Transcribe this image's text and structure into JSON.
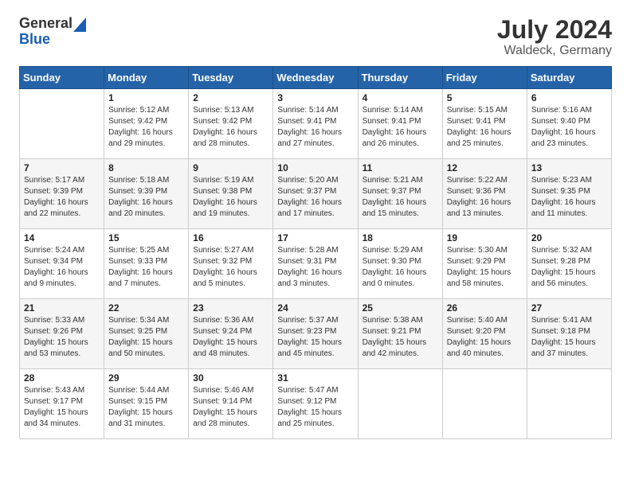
{
  "header": {
    "logo_general": "General",
    "logo_blue": "Blue",
    "title": "July 2024",
    "subtitle": "Waldeck, Germany"
  },
  "calendar": {
    "days_of_week": [
      "Sunday",
      "Monday",
      "Tuesday",
      "Wednesday",
      "Thursday",
      "Friday",
      "Saturday"
    ],
    "weeks": [
      [
        {
          "num": "",
          "info": ""
        },
        {
          "num": "1",
          "info": "Sunrise: 5:12 AM\nSunset: 9:42 PM\nDaylight: 16 hours\nand 29 minutes."
        },
        {
          "num": "2",
          "info": "Sunrise: 5:13 AM\nSunset: 9:42 PM\nDaylight: 16 hours\nand 28 minutes."
        },
        {
          "num": "3",
          "info": "Sunrise: 5:14 AM\nSunset: 9:41 PM\nDaylight: 16 hours\nand 27 minutes."
        },
        {
          "num": "4",
          "info": "Sunrise: 5:14 AM\nSunset: 9:41 PM\nDaylight: 16 hours\nand 26 minutes."
        },
        {
          "num": "5",
          "info": "Sunrise: 5:15 AM\nSunset: 9:41 PM\nDaylight: 16 hours\nand 25 minutes."
        },
        {
          "num": "6",
          "info": "Sunrise: 5:16 AM\nSunset: 9:40 PM\nDaylight: 16 hours\nand 23 minutes."
        }
      ],
      [
        {
          "num": "7",
          "info": "Sunrise: 5:17 AM\nSunset: 9:39 PM\nDaylight: 16 hours\nand 22 minutes."
        },
        {
          "num": "8",
          "info": "Sunrise: 5:18 AM\nSunset: 9:39 PM\nDaylight: 16 hours\nand 20 minutes."
        },
        {
          "num": "9",
          "info": "Sunrise: 5:19 AM\nSunset: 9:38 PM\nDaylight: 16 hours\nand 19 minutes."
        },
        {
          "num": "10",
          "info": "Sunrise: 5:20 AM\nSunset: 9:37 PM\nDaylight: 16 hours\nand 17 minutes."
        },
        {
          "num": "11",
          "info": "Sunrise: 5:21 AM\nSunset: 9:37 PM\nDaylight: 16 hours\nand 15 minutes."
        },
        {
          "num": "12",
          "info": "Sunrise: 5:22 AM\nSunset: 9:36 PM\nDaylight: 16 hours\nand 13 minutes."
        },
        {
          "num": "13",
          "info": "Sunrise: 5:23 AM\nSunset: 9:35 PM\nDaylight: 16 hours\nand 11 minutes."
        }
      ],
      [
        {
          "num": "14",
          "info": "Sunrise: 5:24 AM\nSunset: 9:34 PM\nDaylight: 16 hours\nand 9 minutes."
        },
        {
          "num": "15",
          "info": "Sunrise: 5:25 AM\nSunset: 9:33 PM\nDaylight: 16 hours\nand 7 minutes."
        },
        {
          "num": "16",
          "info": "Sunrise: 5:27 AM\nSunset: 9:32 PM\nDaylight: 16 hours\nand 5 minutes."
        },
        {
          "num": "17",
          "info": "Sunrise: 5:28 AM\nSunset: 9:31 PM\nDaylight: 16 hours\nand 3 minutes."
        },
        {
          "num": "18",
          "info": "Sunrise: 5:29 AM\nSunset: 9:30 PM\nDaylight: 16 hours\nand 0 minutes."
        },
        {
          "num": "19",
          "info": "Sunrise: 5:30 AM\nSunset: 9:29 PM\nDaylight: 15 hours\nand 58 minutes."
        },
        {
          "num": "20",
          "info": "Sunrise: 5:32 AM\nSunset: 9:28 PM\nDaylight: 15 hours\nand 56 minutes."
        }
      ],
      [
        {
          "num": "21",
          "info": "Sunrise: 5:33 AM\nSunset: 9:26 PM\nDaylight: 15 hours\nand 53 minutes."
        },
        {
          "num": "22",
          "info": "Sunrise: 5:34 AM\nSunset: 9:25 PM\nDaylight: 15 hours\nand 50 minutes."
        },
        {
          "num": "23",
          "info": "Sunrise: 5:36 AM\nSunset: 9:24 PM\nDaylight: 15 hours\nand 48 minutes."
        },
        {
          "num": "24",
          "info": "Sunrise: 5:37 AM\nSunset: 9:23 PM\nDaylight: 15 hours\nand 45 minutes."
        },
        {
          "num": "25",
          "info": "Sunrise: 5:38 AM\nSunset: 9:21 PM\nDaylight: 15 hours\nand 42 minutes."
        },
        {
          "num": "26",
          "info": "Sunrise: 5:40 AM\nSunset: 9:20 PM\nDaylight: 15 hours\nand 40 minutes."
        },
        {
          "num": "27",
          "info": "Sunrise: 5:41 AM\nSunset: 9:18 PM\nDaylight: 15 hours\nand 37 minutes."
        }
      ],
      [
        {
          "num": "28",
          "info": "Sunrise: 5:43 AM\nSunset: 9:17 PM\nDaylight: 15 hours\nand 34 minutes."
        },
        {
          "num": "29",
          "info": "Sunrise: 5:44 AM\nSunset: 9:15 PM\nDaylight: 15 hours\nand 31 minutes."
        },
        {
          "num": "30",
          "info": "Sunrise: 5:46 AM\nSunset: 9:14 PM\nDaylight: 15 hours\nand 28 minutes."
        },
        {
          "num": "31",
          "info": "Sunrise: 5:47 AM\nSunset: 9:12 PM\nDaylight: 15 hours\nand 25 minutes."
        },
        {
          "num": "",
          "info": ""
        },
        {
          "num": "",
          "info": ""
        },
        {
          "num": "",
          "info": ""
        }
      ]
    ]
  }
}
